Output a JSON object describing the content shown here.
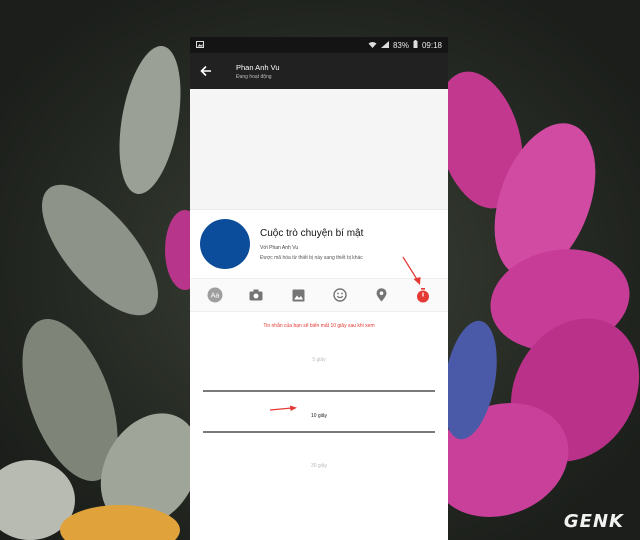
{
  "status_bar": {
    "battery": "83%",
    "time": "09:18"
  },
  "header": {
    "name": "Phan Anh Vu",
    "status": "Đang hoạt động"
  },
  "conversation_card": {
    "title": "Cuộc trò chuyện bí mật",
    "with": "Với Phan Anh Vu",
    "encryption_note": "Được mã hóa từ thiết bị này sang thiết bị khác"
  },
  "toolbar": {
    "icons": [
      "text-format-icon",
      "camera-icon",
      "image-icon",
      "emoji-icon",
      "location-icon",
      "timer-icon"
    ],
    "accent_color": "#e53935"
  },
  "timer_notice": "Tin nhắn của bạn sẽ biến mất 10 giây sau khi xem",
  "timer_picker": {
    "options": [
      "5 giây",
      "10 giây",
      "30 giây"
    ],
    "selected": "10 giây"
  },
  "watermark": "GENK"
}
